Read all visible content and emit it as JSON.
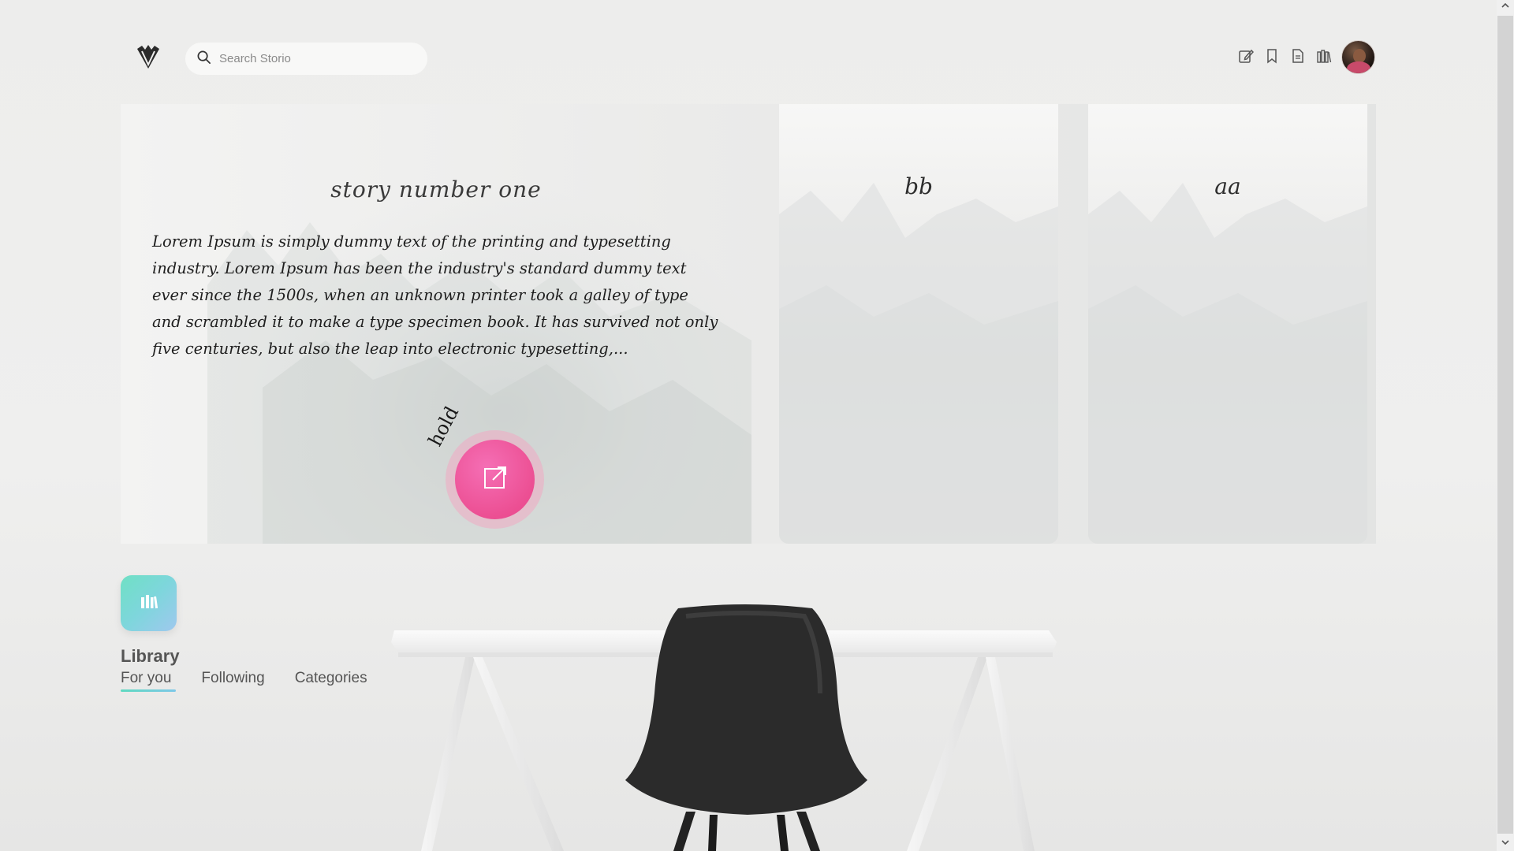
{
  "header": {
    "search_placeholder": "Search Storio",
    "icons": [
      "edit-icon",
      "bookmark-icon",
      "document-icon",
      "library-icon"
    ]
  },
  "hero": {
    "story_title": "story number one",
    "story_body": "Lorem Ipsum is simply dummy text of the printing and typesetting industry. Lorem Ipsum has been the industry's standard dummy text ever since the 1500s, when an unknown printer took a galley of type and scrambled it to make a type specimen book. It has survived not only five centuries, but also the leap into electronic typesetting,...",
    "hold_label": "hold",
    "cards": [
      {
        "title": "bb"
      },
      {
        "title": "aa"
      }
    ]
  },
  "library": {
    "title": "Library",
    "tabs": [
      {
        "label": "For you",
        "active": true
      },
      {
        "label": "Following",
        "active": false
      },
      {
        "label": "Categories",
        "active": false
      }
    ]
  },
  "colors": {
    "accent_pink": "#ec4f93",
    "accent_teal": "#6fe0c4",
    "background": "#efefee"
  }
}
